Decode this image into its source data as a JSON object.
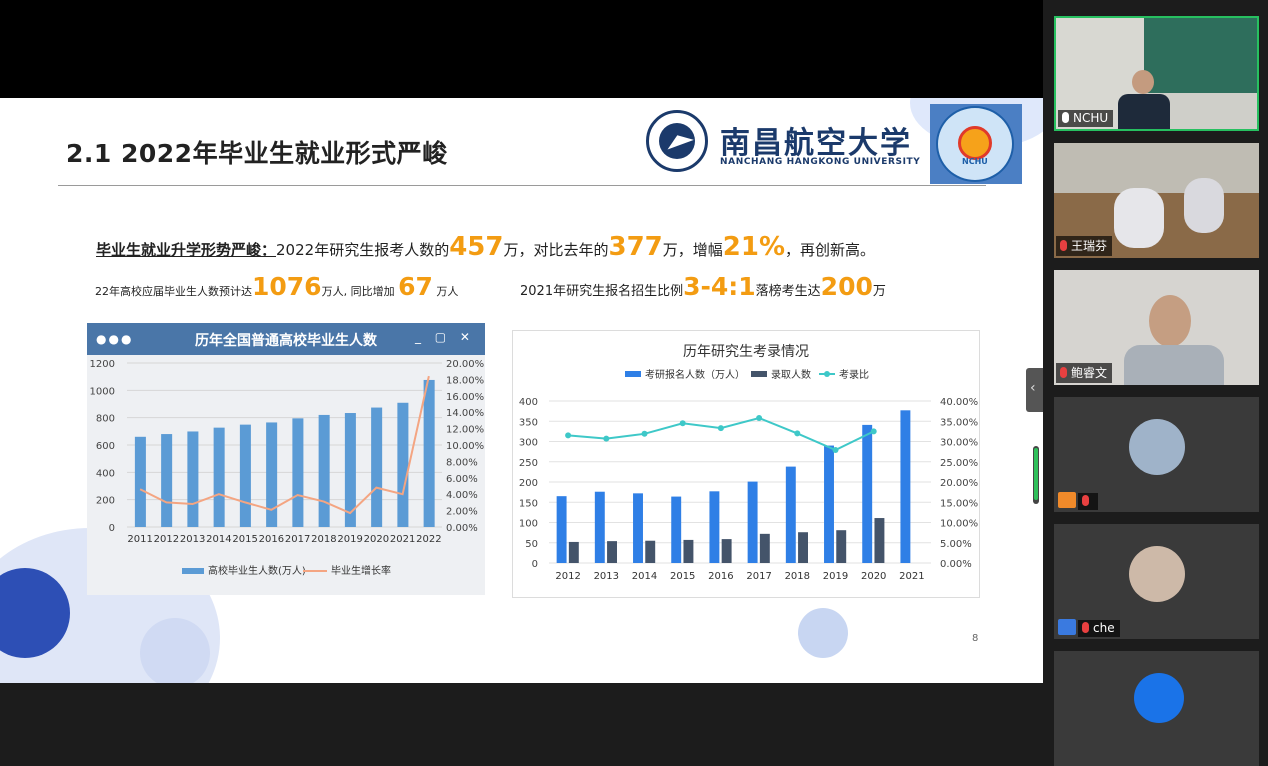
{
  "slide": {
    "title": "2.1 2022年毕业生就业形式严峻",
    "university": {
      "name_cn": "南昌航空大学",
      "name_en": "NANCHANG HANGKONG UNIVERSITY",
      "badge": "NCHU"
    },
    "line1": {
      "lead": "毕业生就业升学形势严峻：",
      "t1": "2022年研究生报考人数的",
      "n1": "457",
      "t2": "万，对比去年的",
      "n2": "377",
      "t3": "万，增幅",
      "n3": "21%",
      "t4": "，再创新高。"
    },
    "line2": {
      "t1": "22年高校应届毕业生人数预计达",
      "n1": "1076",
      "t2": "万人, 同比增加",
      "n2": "67",
      "t3": "万人"
    },
    "line3": {
      "t1": "2021年研究生报名招生比例",
      "n1": "3-4:1",
      "t2": "落榜考生达",
      "n2": "200",
      "t3": "万"
    },
    "page_number": "8"
  },
  "chart_data": [
    {
      "type": "bar",
      "title": "历年全国普通高校毕业生人数",
      "window_dots": "●●●",
      "window_controls": "_ ▢ ✕",
      "categories": [
        "2011",
        "2012",
        "2013",
        "2014",
        "2015",
        "2016",
        "2017",
        "2018",
        "2019",
        "2020",
        "2021",
        "2022"
      ],
      "series": [
        {
          "name": "高校毕业生人数(万人)",
          "type": "bar",
          "axis": "left",
          "color": "#5b9bd5",
          "values": [
            660,
            680,
            699,
            727,
            749,
            765,
            795,
            820,
            834,
            874,
            909,
            1076
          ]
        },
        {
          "name": "毕业生增长率",
          "type": "line",
          "axis": "right",
          "color": "#f4a582",
          "values": [
            4.6,
            3.0,
            2.8,
            4.0,
            3.0,
            2.1,
            3.9,
            3.1,
            1.7,
            4.8,
            4.0,
            18.4
          ]
        }
      ],
      "y_left": {
        "min": 0,
        "max": 1200,
        "ticks": [
          "0",
          "200",
          "400",
          "600",
          "800",
          "1000",
          "1200"
        ]
      },
      "y_right": {
        "min": 0,
        "max": 20,
        "ticks": [
          "0.00%",
          "2.00%",
          "4.00%",
          "6.00%",
          "8.00%",
          "10.00%",
          "12.00%",
          "14.00%",
          "16.00%",
          "18.00%",
          "20.00%"
        ]
      },
      "legend_position": "bottom",
      "grid": true
    },
    {
      "type": "bar",
      "title": "历年研究生考录情况",
      "categories": [
        "2012",
        "2013",
        "2014",
        "2015",
        "2016",
        "2017",
        "2018",
        "2019",
        "2020",
        "2021"
      ],
      "series": [
        {
          "name": "考研报名人数（万人）",
          "type": "bar",
          "axis": "left",
          "color": "#2f7fe6",
          "values": [
            165,
            176,
            172,
            164,
            177,
            201,
            238,
            290,
            341,
            377
          ]
        },
        {
          "name": "录取人数",
          "type": "bar",
          "axis": "left",
          "color": "#44546a",
          "values": [
            52,
            54,
            55,
            57,
            59,
            72,
            76,
            81,
            111
          ]
        },
        {
          "name": "考录比",
          "type": "line",
          "axis": "right",
          "color": "#3ec8c8",
          "values": [
            31.5,
            30.7,
            31.9,
            34.5,
            33.3,
            35.8,
            32.0,
            27.9,
            32.5
          ]
        }
      ],
      "y_left": {
        "min": 0,
        "max": 400,
        "ticks": [
          "0",
          "50",
          "100",
          "150",
          "200",
          "250",
          "300",
          "350",
          "400"
        ]
      },
      "y_right": {
        "min": 0,
        "max": 40,
        "ticks": [
          "0.00%",
          "5.00%",
          "10.00%",
          "15.00%",
          "20.00%",
          "25.00%",
          "30.00%",
          "35.00%",
          "40.00%"
        ]
      },
      "legend_position": "top",
      "grid": true
    }
  ],
  "participants": [
    {
      "name": "NCHU",
      "active": true
    },
    {
      "name": "王瑞芬"
    },
    {
      "name": "鲍睿文"
    },
    {
      "name": ""
    },
    {
      "name": "che"
    },
    {
      "name": ""
    }
  ],
  "colors": {
    "accent_orange": "#f39c12",
    "active_border": "#27c060"
  }
}
